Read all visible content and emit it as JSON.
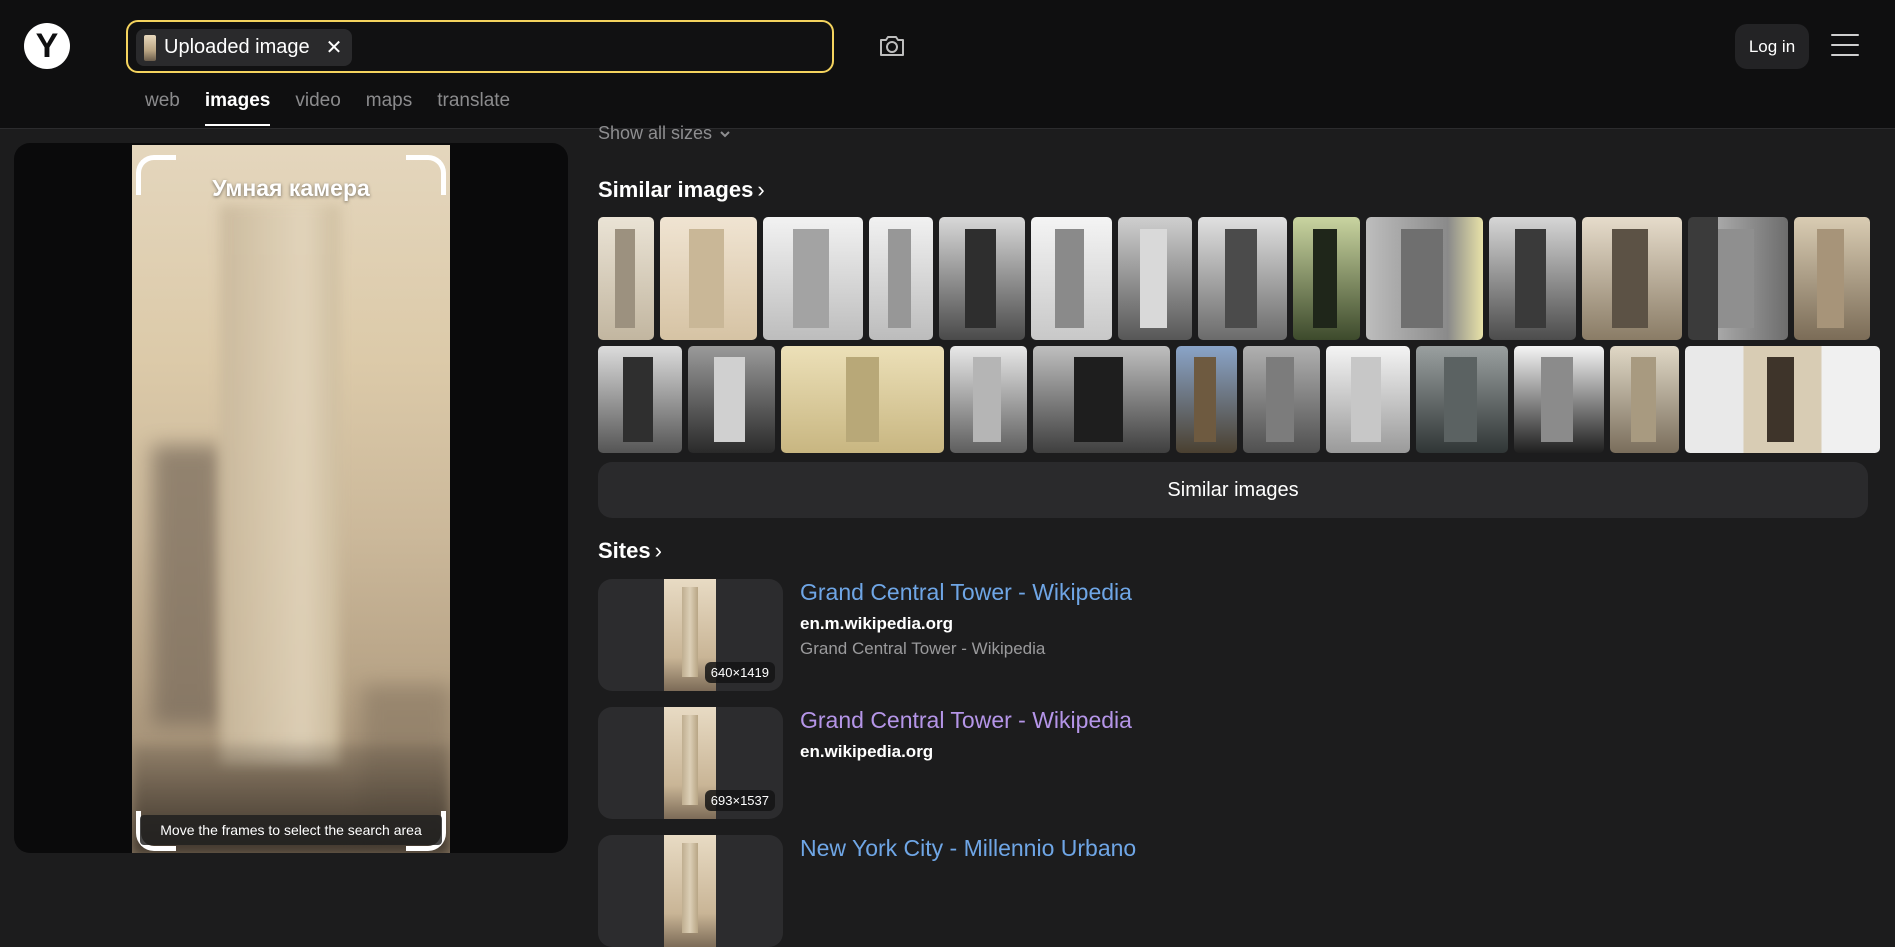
{
  "header": {
    "logo": "Y",
    "search_chip_label": "Uploaded image",
    "login_label": "Log in",
    "tabs": [
      {
        "label": "web"
      },
      {
        "label": "images"
      },
      {
        "label": "video"
      },
      {
        "label": "maps"
      },
      {
        "label": "translate"
      }
    ]
  },
  "preview": {
    "title": "Умная камера",
    "hint": "Move the frames to select the search area"
  },
  "results": {
    "show_sizes": "Show all sizes",
    "similar_title": "Similar images",
    "similar_button": "Similar images",
    "sites_title": "Sites",
    "sites": [
      {
        "title": "Grand Central Tower - Wikipedia",
        "domain": "en.m.wikipedia.org",
        "desc": "Grand Central Tower - Wikipedia",
        "size": "640×1419",
        "visited": false
      },
      {
        "title": "Grand Central Tower - Wikipedia",
        "domain": "en.wikipedia.org",
        "desc": "",
        "size": "693×1537",
        "visited": true
      },
      {
        "title": "New York City - Millennio Urbano",
        "domain": "",
        "desc": "",
        "size": "",
        "visited": false
      }
    ]
  },
  "colors": {
    "accent_border": "#f4d35e",
    "link": "#6fa6e6",
    "link_visited": "#b595e8"
  }
}
